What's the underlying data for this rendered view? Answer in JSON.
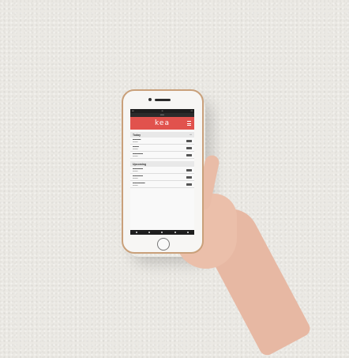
{
  "app": {
    "logo": "kea",
    "accent_color": "#e1524d",
    "frame_color": "#c9a07a"
  },
  "sections": [
    {
      "title": "Today",
      "rows": 3
    },
    {
      "title": "Upcoming",
      "rows": 3
    }
  ],
  "icons": {
    "menu": "hamburger-icon"
  }
}
